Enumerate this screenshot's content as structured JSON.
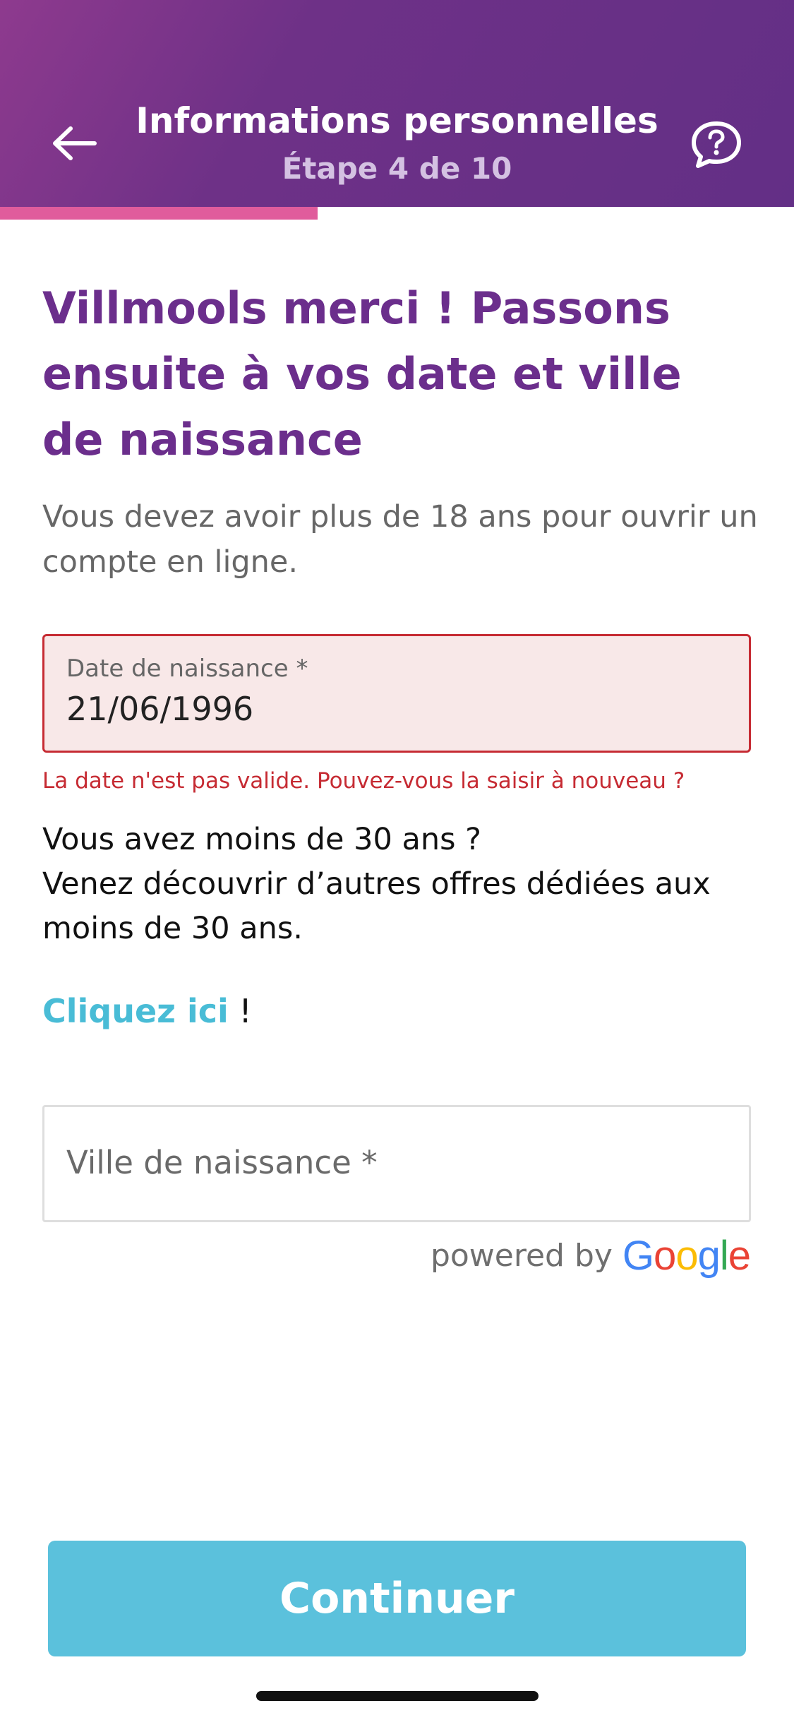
{
  "header": {
    "title": "Informations personnelles",
    "subtitle": "Étape 4 de 10",
    "back_icon": "arrow-left-icon",
    "help_icon": "help-chat-bubble-icon",
    "progress_fraction": 0.4
  },
  "main": {
    "heading": "Villmools merci ! Passons ensuite à vos date et ville de naissance",
    "intro": "Vous devez avoir plus de 18 ans pour ouvrir un compte en ligne.",
    "date_field": {
      "label": "Date de naissance *",
      "value": "21/06/1996",
      "error": "La date n'est pas valide. Pouvez-vous la saisir à nouveau ?"
    },
    "young_offer": {
      "line1": "Vous avez moins de 30 ans ?",
      "line2": "Venez découvrir d’autres offres dédiées aux",
      "line3": "moins de 30 ans.",
      "link": "Cliquez ici",
      "suffix": " !"
    },
    "city_field": {
      "placeholder": "Ville de naissance *"
    },
    "powered_by": {
      "text": "powered by",
      "brand_letters": [
        "G",
        "o",
        "o",
        "g",
        "l",
        "e"
      ]
    }
  },
  "footer": {
    "continue_label": "Continuer"
  },
  "colors": {
    "brand_purple": "#6b2e8c",
    "progress_pink": "#e05c9c",
    "error_red": "#c62b33",
    "accent_cyan": "#5bc1dc"
  }
}
